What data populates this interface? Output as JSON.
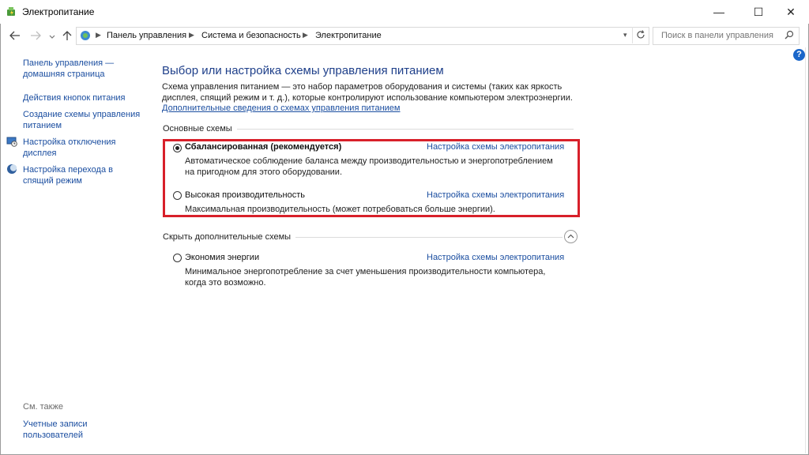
{
  "window": {
    "title": "Электропитание",
    "controls": {
      "minimize": "—",
      "maximize": "☐",
      "close": "✕"
    }
  },
  "address": {
    "breadcrumbs": [
      "Панель управления",
      "Система и безопасность",
      "Электропитание"
    ],
    "search_placeholder": "Поиск в панели управления"
  },
  "sidebar": {
    "home_label": "Панель управления — домашняя страница",
    "items": [
      {
        "label": "Действия кнопок питания",
        "icon": null
      },
      {
        "label": "Создание схемы управления питанием",
        "icon": null
      },
      {
        "label": "Настройка отключения дисплея",
        "icon": "monitor-clock-icon"
      },
      {
        "label": "Настройка перехода в спящий режим",
        "icon": "moon-icon"
      }
    ],
    "see_also_label": "См. также",
    "see_also_items": [
      {
        "label": "Учетные записи пользователей"
      }
    ]
  },
  "main": {
    "heading": "Выбор или настройка схемы управления питанием",
    "intro": "Схема управления питанием — это набор параметров оборудования и системы (таких как яркость дисплея, спящий режим и т. д.), которые контролируют использование компьютером электроэнергии.",
    "intro_link": "Дополнительные сведения о схемах управления питанием",
    "basic_group_label": "Основные схемы",
    "plans": [
      {
        "name": "Сбалансированная (рекомендуется)",
        "selected": true,
        "link": "Настройка схемы электропитания",
        "description": "Автоматическое соблюдение баланса между производительностью и энергопотреблением на пригодном для этого оборудовании."
      },
      {
        "name": "Высокая производительность",
        "selected": false,
        "link": "Настройка схемы электропитания",
        "description": "Максимальная производительность (может потребоваться больше энергии)."
      }
    ],
    "extra_group_label": "Скрыть дополнительные схемы",
    "extra_plans": [
      {
        "name": "Экономия энергии",
        "selected": false,
        "link": "Настройка схемы электропитания",
        "description": "Минимальное энергопотребление за счет уменьшения производительности компьютера, когда это возможно."
      }
    ]
  },
  "colors": {
    "link": "#1b4ea0",
    "heading": "#1e3f8a",
    "highlight_border": "#d8202a",
    "help_badge": "#1a66c9"
  }
}
